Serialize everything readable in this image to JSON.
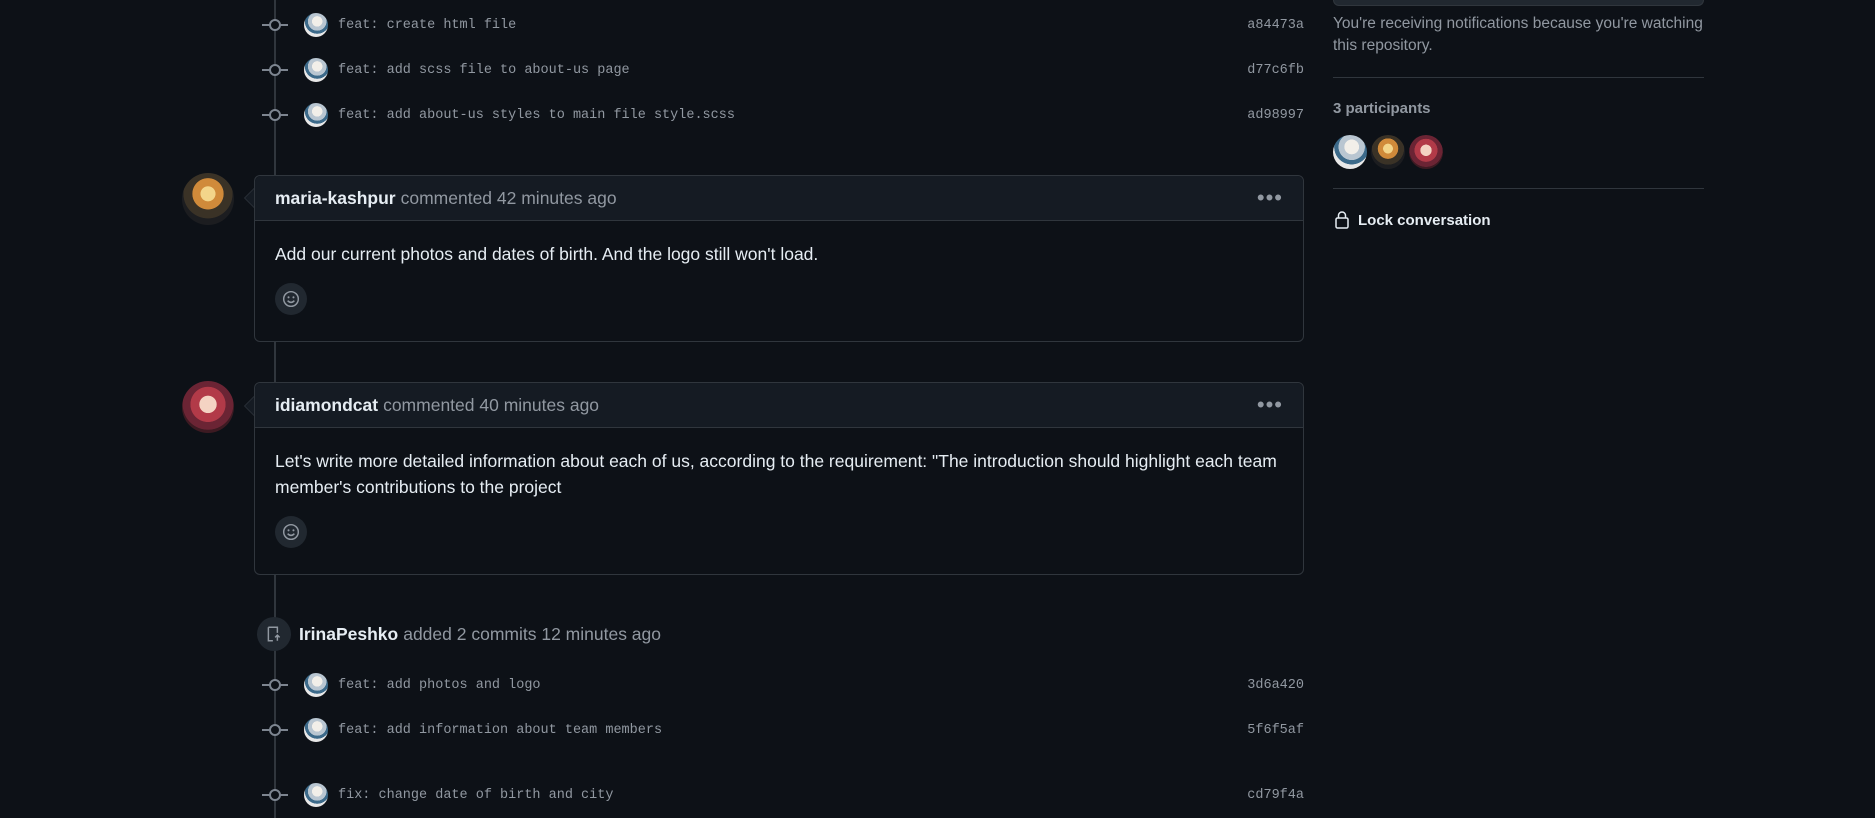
{
  "commits_top": [
    {
      "message": "feat: create html file",
      "sha": "a84473a"
    },
    {
      "message": "feat: add scss file to about-us page",
      "sha": "d77c6fb"
    },
    {
      "message": "feat: add about-us styles to main file style.scss",
      "sha": "ad98997"
    }
  ],
  "comments": [
    {
      "author": "maria-kashpur",
      "meta": "commented 42 minutes ago",
      "body": "Add our current photos and dates of birth. And the logo still won't load.",
      "menu": "•••"
    },
    {
      "author": "idiamondcat",
      "meta": "commented 40 minutes ago",
      "body": "Let's write more detailed information about each of us, according to the requirement: \"The introduction should highlight each team member's contributions to the project",
      "menu": "•••"
    }
  ],
  "push_event": {
    "author": "IrinaPeshko",
    "meta": "added 2 commits 12 minutes ago"
  },
  "commits_bottom": [
    {
      "message": "feat: add photos and logo",
      "sha": "3d6a420"
    },
    {
      "message": "feat: add information about team members",
      "sha": "5f6f5af"
    },
    {
      "message": "fix: change date of birth and city",
      "sha": "cd79f4a"
    }
  ],
  "sidebar": {
    "notification_text": "You're receiving notifications because you're watching this repository.",
    "participants_label": "3 participants",
    "lock_label": "Lock conversation"
  }
}
